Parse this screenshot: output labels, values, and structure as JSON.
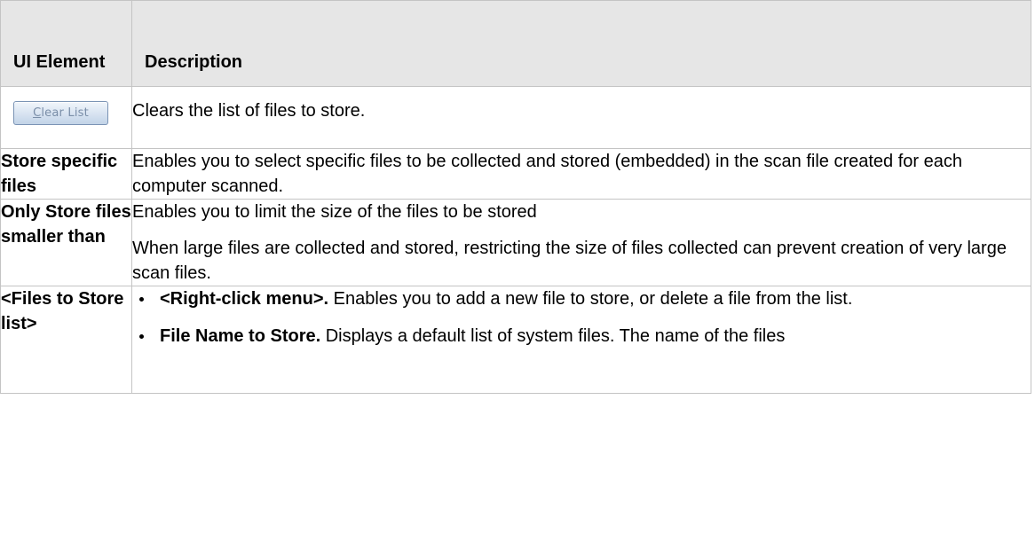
{
  "table": {
    "headers": {
      "element": "UI Element",
      "description": "Description"
    },
    "rows": [
      {
        "element_button": {
          "label_mnemonic": "C",
          "label_rest": "lear List"
        },
        "description": "Clears the list of files to store."
      },
      {
        "element": "Store specific files",
        "description": "Enables you to select specific files to be collected and stored (embedded) in the scan file created for each computer scanned."
      },
      {
        "element": "Only Store files smaller than",
        "description_paragraphs": [
          "Enables you to limit the size of the files to be stored",
          "When large files are collected and stored, restricting the size of files collected can prevent creation of very large scan files."
        ]
      },
      {
        "element": "<Files to Store list>",
        "bullets": [
          {
            "term": "<Right-click menu>.",
            "text": " Enables you to add a new file to store, or delete a file from the list."
          },
          {
            "term": "File Name to Store.",
            "text": " Displays a default list of system files. The name of the files"
          }
        ]
      }
    ]
  }
}
